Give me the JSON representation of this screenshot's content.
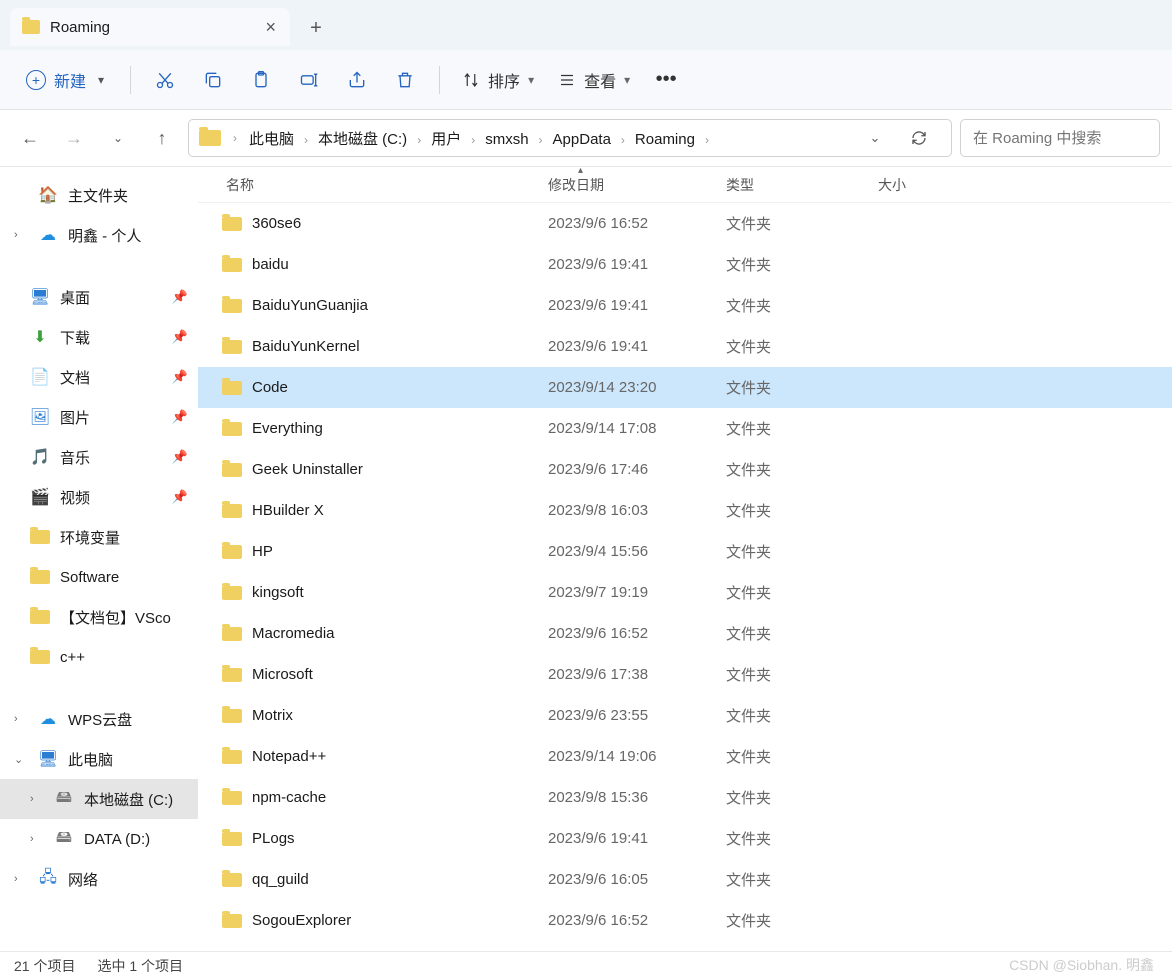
{
  "tab": {
    "title": "Roaming"
  },
  "toolbar": {
    "new_label": "新建",
    "sort_label": "排序",
    "view_label": "查看"
  },
  "breadcrumb": [
    "此电脑",
    "本地磁盘 (C:)",
    "用户",
    "smxsh",
    "AppData",
    "Roaming"
  ],
  "search": {
    "placeholder": "在 Roaming 中搜索"
  },
  "sidebar": {
    "home": "主文件夹",
    "onedrive": "明鑫 - 个人",
    "quick": [
      {
        "label": "桌面",
        "pinned": true
      },
      {
        "label": "下载",
        "pinned": true
      },
      {
        "label": "文档",
        "pinned": true
      },
      {
        "label": "图片",
        "pinned": true
      },
      {
        "label": "音乐",
        "pinned": true
      },
      {
        "label": "视频",
        "pinned": true
      },
      {
        "label": "环境变量",
        "pinned": false
      },
      {
        "label": "Software",
        "pinned": false
      },
      {
        "label": "【文档包】VSco",
        "pinned": false
      },
      {
        "label": "c++",
        "pinned": false
      }
    ],
    "wps": "WPS云盘",
    "pc": "此电脑",
    "drives": [
      {
        "label": "本地磁盘 (C:)",
        "selected": true
      },
      {
        "label": "DATA (D:)",
        "selected": false
      }
    ],
    "network": "网络"
  },
  "columns": {
    "name": "名称",
    "date": "修改日期",
    "type": "类型",
    "size": "大小"
  },
  "type_folder": "文件夹",
  "files": [
    {
      "name": "360se6",
      "date": "2023/9/6 16:52",
      "selected": false
    },
    {
      "name": "baidu",
      "date": "2023/9/6 19:41",
      "selected": false
    },
    {
      "name": "BaiduYunGuanjia",
      "date": "2023/9/6 19:41",
      "selected": false
    },
    {
      "name": "BaiduYunKernel",
      "date": "2023/9/6 19:41",
      "selected": false
    },
    {
      "name": "Code",
      "date": "2023/9/14 23:20",
      "selected": true
    },
    {
      "name": "Everything",
      "date": "2023/9/14 17:08",
      "selected": false
    },
    {
      "name": "Geek Uninstaller",
      "date": "2023/9/6 17:46",
      "selected": false
    },
    {
      "name": "HBuilder X",
      "date": "2023/9/8 16:03",
      "selected": false
    },
    {
      "name": "HP",
      "date": "2023/9/4 15:56",
      "selected": false
    },
    {
      "name": "kingsoft",
      "date": "2023/9/7 19:19",
      "selected": false
    },
    {
      "name": "Macromedia",
      "date": "2023/9/6 16:52",
      "selected": false
    },
    {
      "name": "Microsoft",
      "date": "2023/9/6 17:38",
      "selected": false
    },
    {
      "name": "Motrix",
      "date": "2023/9/6 23:55",
      "selected": false
    },
    {
      "name": "Notepad++",
      "date": "2023/9/14 19:06",
      "selected": false
    },
    {
      "name": "npm-cache",
      "date": "2023/9/8 15:36",
      "selected": false
    },
    {
      "name": "PLogs",
      "date": "2023/9/6 19:41",
      "selected": false
    },
    {
      "name": "qq_guild",
      "date": "2023/9/6 16:05",
      "selected": false
    },
    {
      "name": "SogouExplorer",
      "date": "2023/9/6 16:52",
      "selected": false
    }
  ],
  "status": {
    "count": "21 个项目",
    "selected": "选中 1 个项目"
  },
  "watermark": "CSDN @Siobhan. 明鑫"
}
